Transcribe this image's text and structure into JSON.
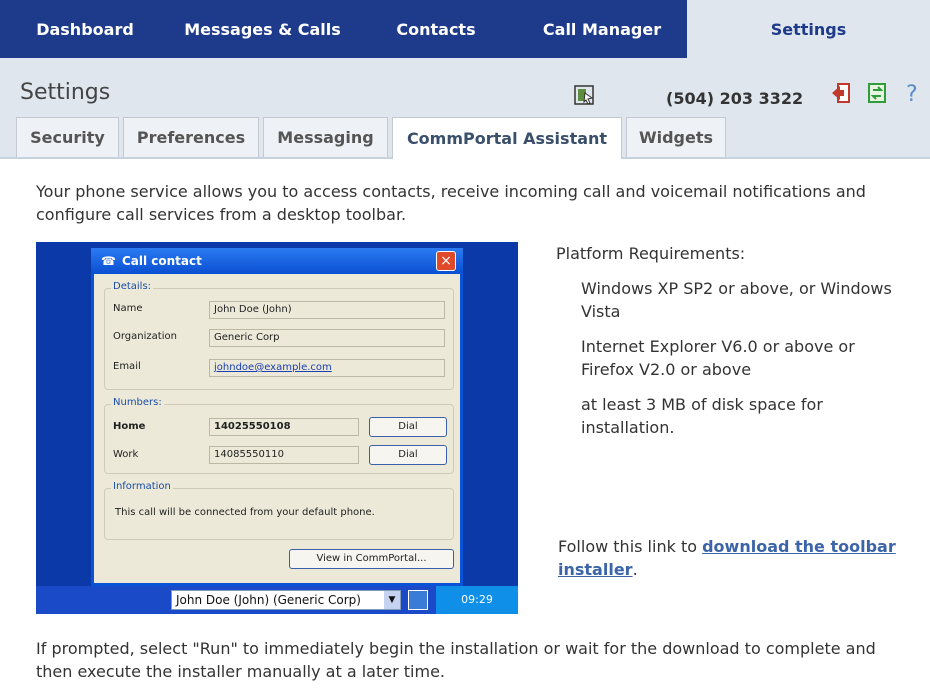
{
  "nav": {
    "tabs": [
      {
        "label": "Dashboard"
      },
      {
        "label": "Messages & Calls"
      },
      {
        "label": "Contacts"
      },
      {
        "label": "Call Manager"
      },
      {
        "label": "Settings"
      }
    ]
  },
  "header": {
    "title": "Settings",
    "phone": "(504) 203 3322",
    "icons": [
      "toolbar-icon",
      "logout-icon",
      "refresh-icon",
      "help-icon"
    ]
  },
  "subtabs": [
    {
      "label": "Security"
    },
    {
      "label": "Preferences"
    },
    {
      "label": "Messaging"
    },
    {
      "label": "CommPortal Assistant"
    },
    {
      "label": "Widgets"
    }
  ],
  "main": {
    "intro": "Your phone service allows you to access contacts, receive incoming call and voicemail notifications and configure call services from a desktop toolbar.",
    "requirements_title": "Platform Requirements:",
    "requirements": [
      "Windows XP SP2 or above, or Windows Vista",
      "Internet Explorer V6.0 or above or Firefox V2.0 or above",
      "at least 3 MB of disk space for installation."
    ],
    "follow_prefix": "Follow this link to ",
    "download_link": "download the toolbar installer",
    "follow_suffix": ".",
    "outro": "If prompted, select \"Run\" to immediately begin the installation or wait for the download to complete and then execute the installer manually at a later time."
  },
  "screenshot": {
    "title": "Call contact",
    "details_label": "Details:",
    "name_label": "Name",
    "name_value": "John Doe (John)",
    "org_label": "Organization",
    "org_value": "Generic Corp",
    "email_label": "Email",
    "email_value": "johndoe@example.com",
    "numbers_label": "Numbers:",
    "home_label": "Home",
    "home_value": "14025550108",
    "work_label": "Work",
    "work_value": "14085550110",
    "dial_label": "Dial",
    "info_label": "Information",
    "info_text": "This call will be connected from your default phone.",
    "view_button": "View in CommPortal...",
    "taskbar_combo": "John Doe (John) (Generic Corp)",
    "clock": "09:29"
  },
  "colors": {
    "nav_bg": "#1e3a8a",
    "header_bg": "#dfe6ee",
    "link": "#3b65a8"
  }
}
